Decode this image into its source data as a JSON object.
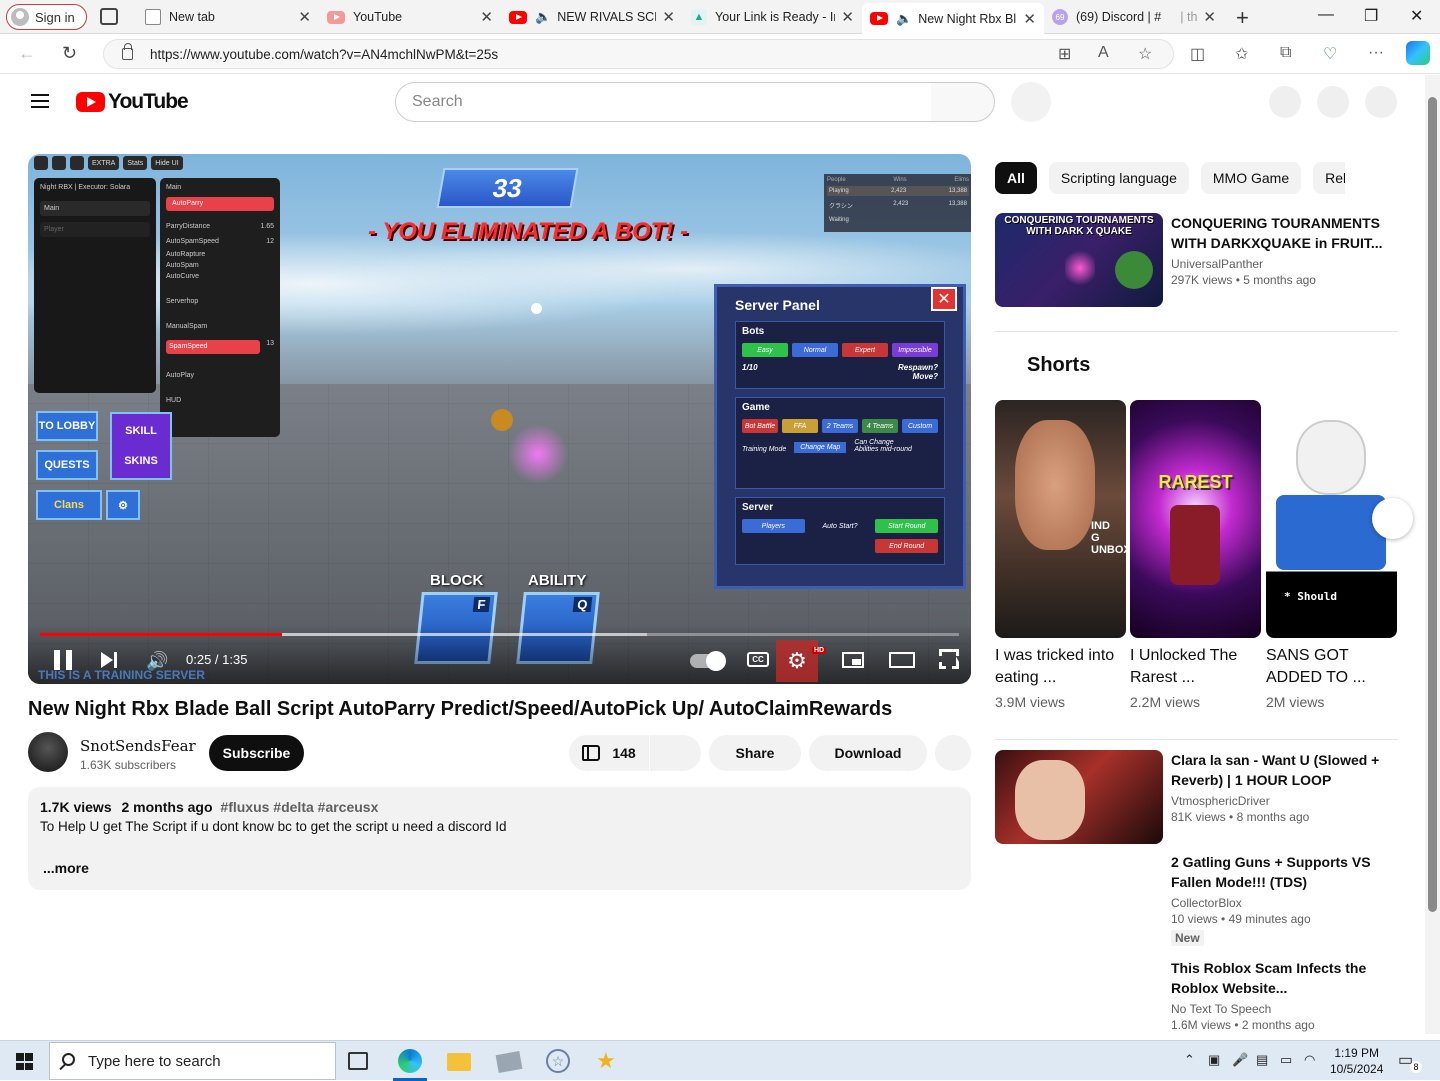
{
  "browser": {
    "signin_label": "Sign in",
    "tabs": [
      {
        "title": "New tab"
      },
      {
        "title": "YouTube"
      },
      {
        "title": "NEW RIVALS SCRI"
      },
      {
        "title": "Your Link is Ready - Ins"
      },
      {
        "title": "New Night Rbx Bl"
      },
      {
        "title": "(69) Discord | #",
        "extra": "| th"
      }
    ],
    "discord_badge": "69",
    "url": "https://www.youtube.com/watch?v=AN4mchlNwPM&t=25s"
  },
  "youtube": {
    "logo_text": "YouTube",
    "search_placeholder": "Search"
  },
  "player": {
    "current_time": "0:25",
    "duration": "1:35",
    "time_display": "0:25 / 1:35",
    "progress_fraction": 0.263,
    "buffered_fraction": 0.66,
    "game": {
      "score": "33",
      "eliminated": "- YOU ELIMINATED A BOT! -",
      "server_panel_title": "Server Panel",
      "close": "✕",
      "bots_label": "Bots",
      "bot_levels": [
        "Easy",
        "Normal",
        "Expert",
        "Impossible"
      ],
      "bot_count": "1/10",
      "respawn": "Respawn?",
      "move": "Move?",
      "game_label": "Game",
      "modes": [
        "Bot Battle",
        "FFA",
        "2 Teams",
        "4 Teams",
        "Custom"
      ],
      "training_mode": "Training Mode",
      "change_map": "Change Map",
      "can_change": "Can Change",
      "abilities_mid_round": "Abilities mid-round",
      "server_label": "Server",
      "players": "Players",
      "auto_start": "Auto Start?",
      "start_round": "Start Round",
      "end_round": "End Round",
      "block": "BLOCK",
      "ability": "ABILITY",
      "block_key": "F",
      "ability_key": "Q",
      "to_lobby": "TO LOBBY",
      "quests": "QUESTS",
      "clans": "Clans",
      "skills": "SKILL",
      "skins": "SKINS",
      "training_server": "THIS IS A TRAINING SERVER",
      "menu_title": "Night RBX | Executor: Solara",
      "menu_main": "Main",
      "menu_player": "Player",
      "main_tab": "Main",
      "autoparry": "AutoParry",
      "parry_distance": "ParryDistance",
      "parry_distance_val": "1.65",
      "autospam_speed": "AutoSpamSpeed",
      "autospam_speed_val": "12",
      "autorapture": "AutoRapture",
      "autospam": "AutoSpam",
      "autocurve": "AutoCurve",
      "serverhop": "Serverhop",
      "manualspam": "ManualSpam",
      "spamspeed": "SpamSpeed",
      "spamspeed_val": "13",
      "autoplay": "AutoPlay",
      "hud": "HUD",
      "extra": "EXTRA",
      "stats": "Stats",
      "hide_ui": "Hide UI",
      "scoreboard": {
        "headers": [
          "People",
          "Wins",
          "Elims"
        ],
        "playing": [
          "Playing",
          "2,423",
          "13,388"
        ],
        "row": [
          "クラシン",
          "2,423",
          "13,388"
        ],
        "waiting": "Waiting"
      }
    },
    "hd_badge": "HD",
    "cc_label": "CC"
  },
  "video": {
    "title": "New Night Rbx Blade Ball Script AutoParry Predict/Speed/AutoPick Up/ AutoClaimRewards",
    "channel": "SnotSendsFear",
    "subscribers": "1.63K subscribers",
    "subscribe_label": "Subscribe",
    "likes": "148",
    "share_label": "Share",
    "download_label": "Download",
    "views": "1.7K views",
    "age": "2 months ago",
    "hashtags": "#fluxus #delta #arceusx",
    "description": "To Help U get The Script if u dont know bc to get the script u need a discord Id",
    "more_label": "...more"
  },
  "sidebar": {
    "chips": [
      "All",
      "Scripting language",
      "MMO Game",
      "Relat"
    ],
    "recommendations": [
      {
        "title": "CONQUERING TOURANMENTS WITH DARKXQUAKE in FRUIT...",
        "channel": "UniversalPanther",
        "views": "297K views",
        "age": "5 months ago",
        "thumb_text": "CONQUERING TOURNAMENTS WITH DARK X QUAKE"
      },
      {
        "title": "Clara la san - Want U (Slowed + Reverb) | 1 HOUR LOOP",
        "channel": "VtmosphericDriver",
        "views": "81K views",
        "age": "8 months ago"
      },
      {
        "title": "2 Gatling Guns + Supports VS Fallen Mode!!! (TDS)",
        "channel": "CollectorBlox",
        "views": "10 views",
        "age": "49 minutes ago",
        "badge": "New"
      },
      {
        "title": "This Roblox Scam Infects the Roblox Website...",
        "channel": "No Text To Speech",
        "views": "1.6M views",
        "age": "2 months ago"
      }
    ],
    "shorts_label": "Shorts",
    "shorts": [
      {
        "title": "I was tricked into eating ...",
        "views": "3.9M views",
        "thumb_text": "IND G UNBOXI"
      },
      {
        "title": "I Unlocked The Rarest ...",
        "views": "2.2M views",
        "thumb_text": "RAREST"
      },
      {
        "title": "SANS GOT ADDED TO ...",
        "views": "2M views",
        "thumb_text": "* Should"
      }
    ]
  },
  "taskbar": {
    "search_placeholder": "Type here to search",
    "time": "1:19 PM",
    "date": "10/5/2024",
    "notif_count": "8"
  }
}
